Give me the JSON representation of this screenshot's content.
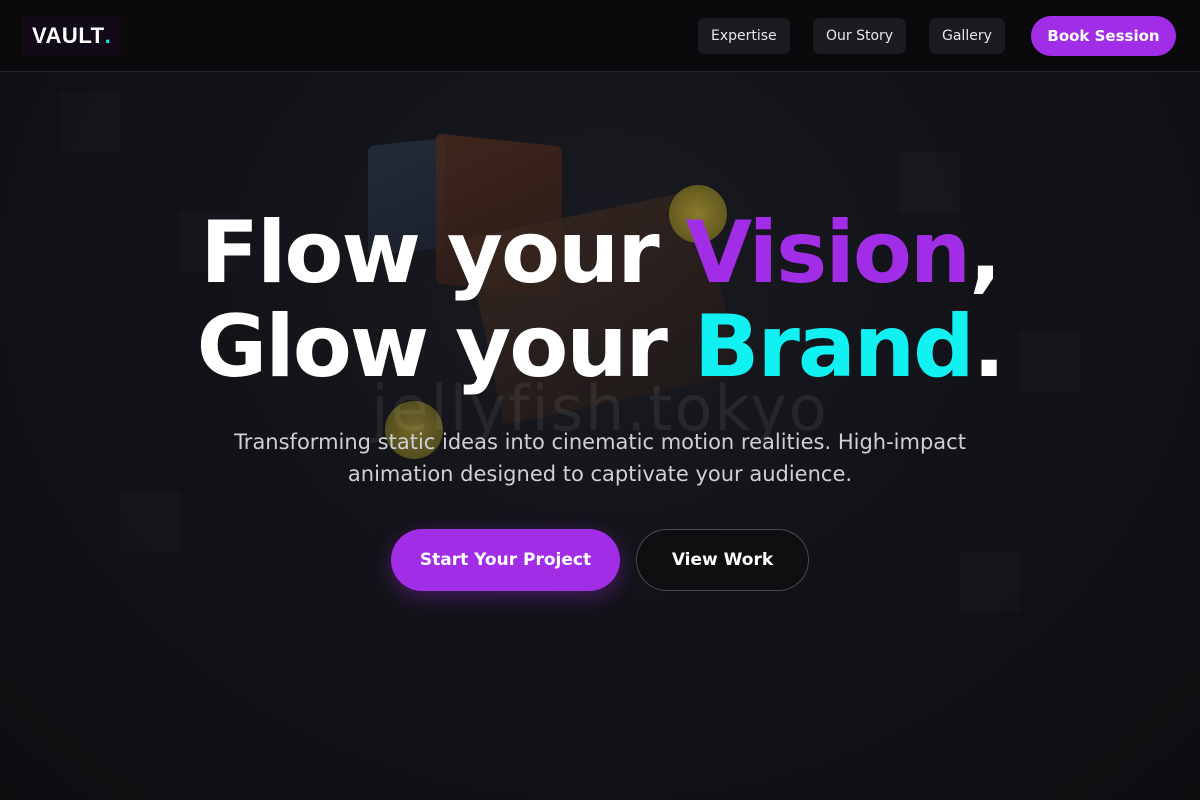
{
  "nav": {
    "logo_text": "VAULT",
    "logo_dot": ".",
    "links": [
      {
        "label": "Expertise"
      },
      {
        "label": "Our Story"
      },
      {
        "label": "Gallery"
      }
    ],
    "cta_label": "Book Session"
  },
  "hero": {
    "line1_prefix": "Flow your ",
    "line1_accent": "Vision",
    "line1_suffix": ",",
    "line2_prefix": "Glow your ",
    "line2_accent": "Brand",
    "line2_suffix": ".",
    "subtitle": "Transforming static ideas into cinematic motion realities. High-impact animation designed to captivate your audience.",
    "primary_cta": "Start Your Project",
    "secondary_cta": "View Work"
  },
  "background": {
    "watermark": "jellyfish.tokyo"
  },
  "colors": {
    "accent_purple": "#a22de6",
    "accent_cyan": "#12f1f1",
    "background": "#101014"
  }
}
